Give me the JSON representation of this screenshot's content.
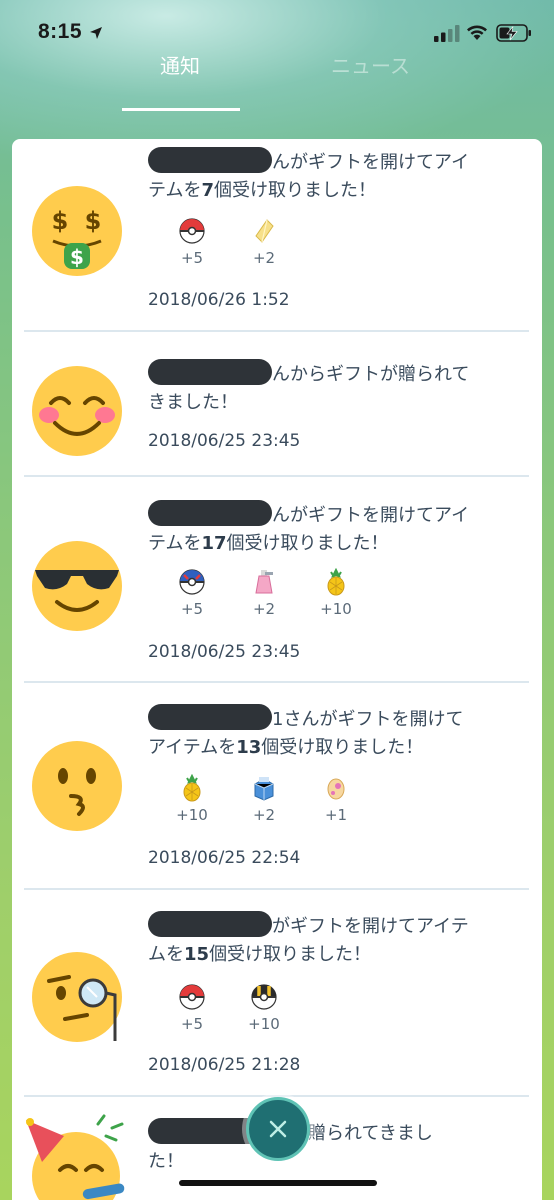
{
  "status_bar": {
    "time": "8:15"
  },
  "tabs": [
    {
      "label": "通知",
      "active": true
    },
    {
      "label": "ニュース",
      "active": false
    }
  ],
  "notifications": [
    {
      "avatar": "money-mouth-emoji-icon",
      "message_line1": "んがギフトを開けてアイ",
      "message_line2_pre": "テムを",
      "count": "7",
      "message_line2_post": "個受け取りました！",
      "rewards": [
        {
          "icon": "poke-ball-icon",
          "count": "+5"
        },
        {
          "icon": "stardust-icon",
          "count": "+2"
        }
      ],
      "date": "2018/06/26 1:52"
    },
    {
      "avatar": "smiling-blush-emoji-icon",
      "message_line1": "んからギフトが贈られて",
      "message_line2": "きました！",
      "date": "2018/06/25 23:45"
    },
    {
      "avatar": "sunglasses-emoji-icon",
      "message_line1": "んがギフトを開けてアイ",
      "message_line2_pre": "テムを",
      "count": "17",
      "message_line2_post": "個受け取りました！",
      "rewards": [
        {
          "icon": "great-ball-icon",
          "count": "+5"
        },
        {
          "icon": "potion-icon",
          "count": "+2"
        },
        {
          "icon": "pinap-berry-icon",
          "count": "+10"
        }
      ],
      "date": "2018/06/25 23:45"
    },
    {
      "avatar": "kissing-emoji-icon",
      "message_line1": "1さんがギフトを開けて",
      "message_line2_pre": "アイテムを",
      "count": "13",
      "message_line2_post": "個受け取りました！",
      "rewards": [
        {
          "icon": "pinap-berry-icon",
          "count": "+10"
        },
        {
          "icon": "revive-icon",
          "count": "+2"
        },
        {
          "icon": "egg-icon",
          "count": "+1"
        }
      ],
      "date": "2018/06/25 22:54"
    },
    {
      "avatar": "monocle-emoji-icon",
      "message_line1": "がギフトを開けてアイテ",
      "message_line2_pre": "ムを",
      "count": "15",
      "message_line2_post": "個受け取りました！",
      "rewards": [
        {
          "icon": "poke-ball-icon",
          "count": "+5"
        },
        {
          "icon": "ultra-ball-icon",
          "count": "+10"
        }
      ],
      "date": "2018/06/25 21:28"
    },
    {
      "avatar": "party-face-emoji-icon",
      "message_line1": "トが贈られてきまし",
      "message_line2": "た！"
    }
  ],
  "close_button_icon": "close-icon",
  "colors": {
    "accent": "#1f6f72",
    "text": "#3a4b5c",
    "separator": "#dce7ee"
  }
}
